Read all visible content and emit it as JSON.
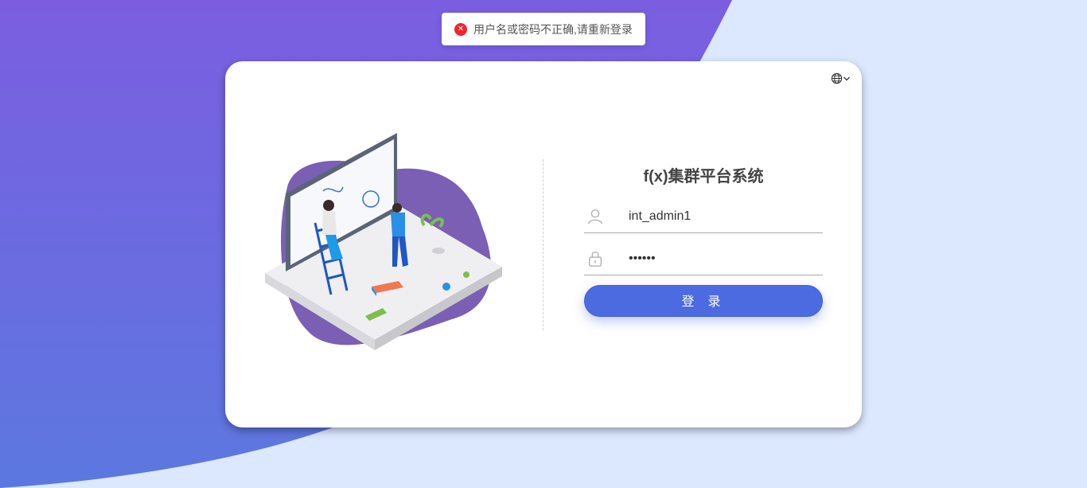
{
  "toast": {
    "message": "用户名或密码不正确,请重新登录",
    "icon": "error-circle-icon",
    "color": "#f5222d"
  },
  "header": {
    "language_icon": "globe-icon"
  },
  "login": {
    "title": "f(x)集群平台系统",
    "username": {
      "value": "int_admin1",
      "icon": "user-icon"
    },
    "password": {
      "value": "••••••",
      "icon": "lock-icon"
    },
    "submit_label": "登 录"
  },
  "colors": {
    "primary": "#4d6be0",
    "bg_purple": "#7b5ee0",
    "bg_light": "#dce8fe"
  }
}
